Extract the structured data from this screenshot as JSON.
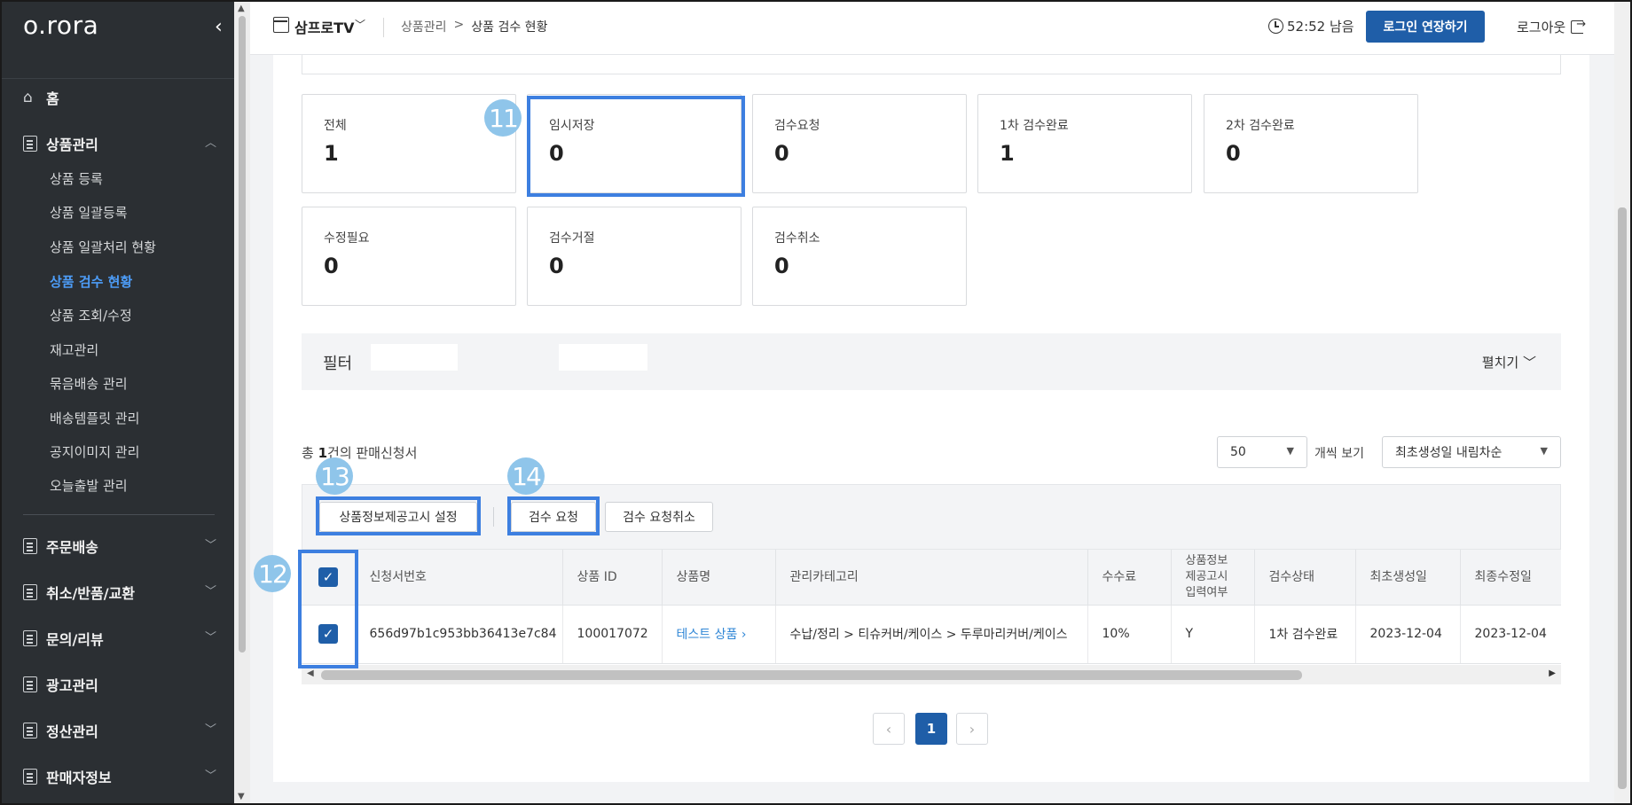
{
  "sidebar": {
    "logo": "o.rora",
    "home": "홈",
    "product_mgmt": "상품관리",
    "sub_items": [
      "상품 등록",
      "상품 일괄등록",
      "상품 일괄처리 현황",
      "상품 검수 현황",
      "상품 조회/수정",
      "재고관리",
      "묶음배송 관리",
      "배송템플릿 관리",
      "공지이미지 관리",
      "오늘출발 관리"
    ],
    "active_sub": "상품 검수 현황",
    "sections": [
      "주문배송",
      "취소/반품/교환",
      "문의/리뷰",
      "광고관리",
      "정산관리",
      "판매자정보"
    ]
  },
  "header": {
    "store": "삼프로TV",
    "breadcrumb_parent": "상품관리",
    "breadcrumb_sep": ">",
    "breadcrumb_current": "상품 검수 현황",
    "timer": "52:52 남음",
    "extend_button": "로그인 연장하기",
    "logout": "로그아웃"
  },
  "stats": [
    {
      "label": "전체",
      "value": "1"
    },
    {
      "label": "임시저장",
      "value": "0"
    },
    {
      "label": "검수요청",
      "value": "0"
    },
    {
      "label": "1차 검수완료",
      "value": "1"
    },
    {
      "label": "2차 검수완료",
      "value": "0"
    },
    {
      "label": "수정필요",
      "value": "0"
    },
    {
      "label": "검수거절",
      "value": "0"
    },
    {
      "label": "검수취소",
      "value": "0"
    }
  ],
  "filter": {
    "title": "필터",
    "toggle": "펼치기"
  },
  "list": {
    "total_prefix": "총 ",
    "total_count": "1",
    "total_suffix": "건의 판매신청서",
    "page_size": "50",
    "per_page_label": "개씩 보기",
    "sort": "최초생성일 내림차순"
  },
  "actions": {
    "notice_setting": "상품정보제공고시 설정",
    "request_review": "검수 요청",
    "cancel_review": "검수 요청취소"
  },
  "table": {
    "headers": [
      "신청서번호",
      "상품 ID",
      "상품명",
      "관리카테고리",
      "수수료",
      "상품정보\n제공고시\n입력여부",
      "검수상태",
      "최초생성일",
      "최종수정일"
    ],
    "rows": [
      {
        "application_no": "656d97b1c953bb36413e7c84",
        "product_id": "100017072",
        "product_name": "테스트 상품",
        "category": "수납/정리 > 티슈커버/케이스 > 두루마리커버/케이스",
        "fee": "10%",
        "notice": "Y",
        "status": "1차 검수완료",
        "created": "2023-12-04",
        "updated": "2023-12-04"
      }
    ]
  },
  "pagination": {
    "current": "1"
  },
  "annotations": {
    "badge11": "11",
    "badge12": "12",
    "badge13": "13",
    "badge14": "14"
  },
  "colors": {
    "primary": "#1f5ea8",
    "highlight": "#3d7fe0",
    "badge": "#8fc5ea",
    "link": "#2f86d6",
    "sidebar": "#2b2f33"
  }
}
